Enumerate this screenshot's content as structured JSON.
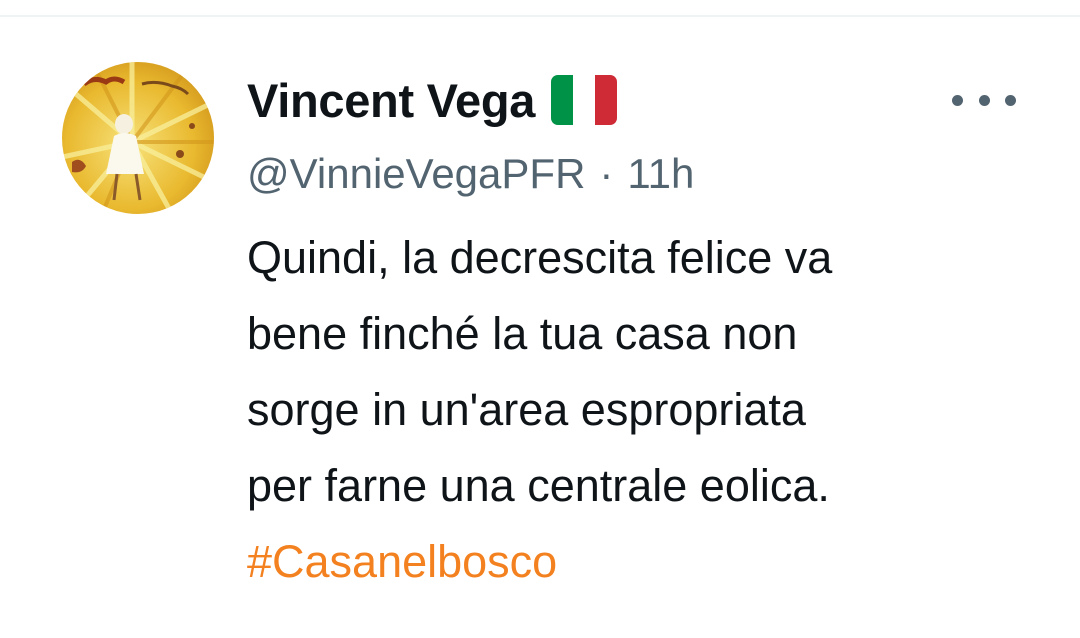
{
  "author": {
    "display_name": "Vincent Vega",
    "flag_emoji": "italy-flag",
    "handle": "@VinnieVegaPFR",
    "separator": "·",
    "timestamp": "11h"
  },
  "tweet": {
    "lines": [
      "Quindi, la decrescita felice va",
      "bene finché la tua casa non",
      "sorge in un'area espropriata",
      "per farne una centrale eolica."
    ],
    "hashtag": "#Casanelbosco"
  },
  "menu": {
    "icon": "more-horizontal-icon"
  },
  "colors": {
    "text": "#0f1419",
    "secondary": "#536471",
    "hashtag": "#f4811f",
    "flag_green": "#009246",
    "flag_white": "#ffffff",
    "flag_red": "#ce2b37"
  }
}
